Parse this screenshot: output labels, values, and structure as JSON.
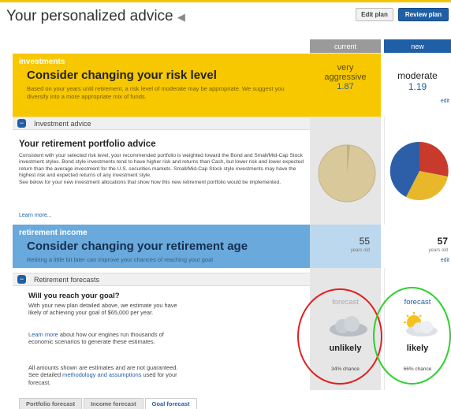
{
  "header": {
    "title": "Your personalized advice",
    "edit_plan": "Edit plan",
    "review_plan": "Review plan"
  },
  "columns": {
    "current": "current",
    "new": "new"
  },
  "investments": {
    "ribbon": "investments",
    "title": "Consider changing your risk level",
    "subtitle": "Based on your years until retirement, a risk level of moderate may be appropriate. We suggest you diversify into a more appropriate mix of funds.",
    "current_risk_line1": "very",
    "current_risk_line2": "aggressive",
    "current_risk_value": "1.87",
    "new_risk": "moderate",
    "new_risk_value": "1.19",
    "edit": "edit"
  },
  "investment_advice": {
    "label": "Investment advice",
    "heading": "Your retirement portfolio advice",
    "body1": "Consistent with your selected risk level, your recommended portfolio is weighted toward the Bond and Small/Mid-Cap Stock investment styles. Bond style investments tend to have higher risk and returns than Cash, but lower risk and lower expected return than the average investment for the U.S. securities markets. Small/Mid-Cap Stock style investments may have the highest risk and expected returns of any investment style.",
    "body2": "See below for your new investment allocations that show how this new retirement portfolio would be implemented.",
    "learn_more": "Learn more..."
  },
  "retirement_income": {
    "ribbon": "retirement income",
    "title": "Consider changing your retirement age",
    "subtitle": "Retiring a little bit later can improve your chances of reaching your goal",
    "current_age": "55",
    "new_age": "57",
    "age_unit": "years old",
    "edit": "edit"
  },
  "forecasts": {
    "label": "Retirement forecasts",
    "heading": "Will you reach your goal?",
    "p1": "With your new plan detailed above, we estimate you have likely of achieving your goal of $65,000 per year.",
    "p2_link": "Learn more",
    "p2_rest": " about how our engines run thousands of economic scenarios to generate these estimates.",
    "p3_a": "All amounts shown are estimates and are not guaranteed. See detailed ",
    "p3_link": "methodology and assumptions",
    "p3_b": " used for your forecast.",
    "forecast_label": "forecast",
    "current_outcome": "unlikely",
    "current_chance": "34% chance",
    "new_outcome": "likely",
    "new_chance": "66% chance"
  },
  "tabs": [
    "Portfolio forecast",
    "Income forecast",
    "Goal forecast"
  ],
  "colors": {
    "yellow": "#f7c800",
    "blue_banner": "#6aa9dc",
    "brand_blue": "#1f5fa6",
    "ring_red": "#e02020",
    "ring_green": "#2bd12b"
  }
}
